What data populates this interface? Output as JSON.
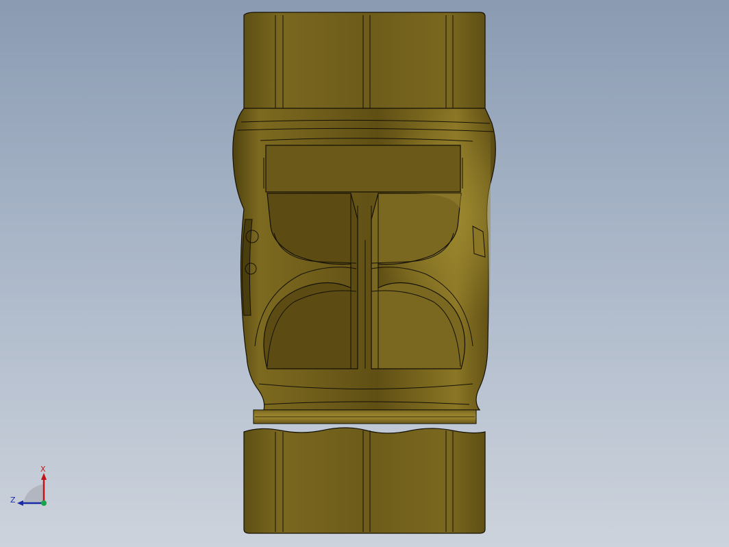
{
  "viewport": {
    "background_top": "#8a9bb2",
    "background_bottom": "#cdd3dc"
  },
  "model": {
    "name": "",
    "body_color": "#6b5a18",
    "highlight_color": "#8a7622",
    "edge_color": "#141005"
  },
  "triad": {
    "x_label": "X",
    "z_label": "Z",
    "x_color": "#c0141a",
    "z_color": "#1a2aa8",
    "origin_color": "#19a64a"
  }
}
